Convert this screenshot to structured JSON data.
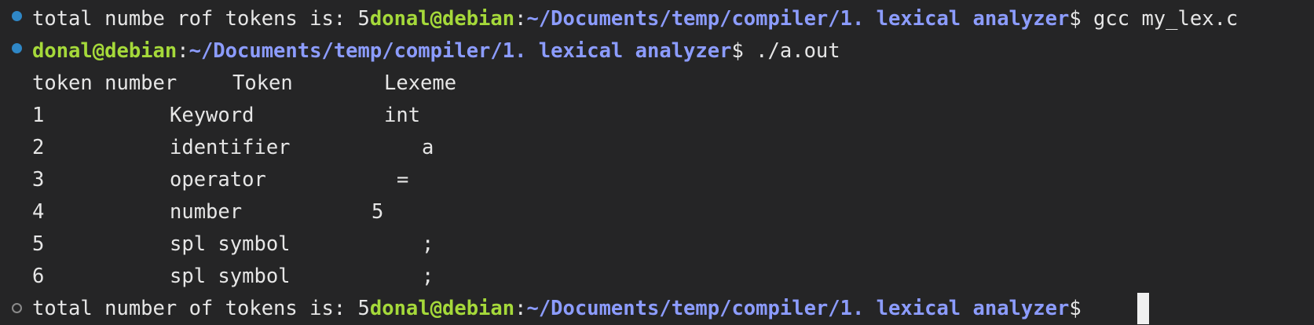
{
  "terminal": {
    "colors": {
      "background": "#252526",
      "user": "#a5d93a",
      "path": "#8c9cff",
      "text": "#e6e6e6",
      "status_dot_success": "#2f87c6",
      "status_dot_empty": "#8a8a8a"
    },
    "line1": {
      "output": "total numbe rof tokens is: 5",
      "user": "donal@debian",
      "sep": ":",
      "path": "~/Documents/temp/compiler/1. lexical analyzer",
      "prompt": "$ ",
      "command": "gcc my_lex.c"
    },
    "line2": {
      "user": "donal@debian",
      "sep": ":",
      "path": "~/Documents/temp/compiler/1. lexical analyzer",
      "prompt": "$ ",
      "command": "./a.out"
    },
    "table": {
      "headers": {
        "number": "token number",
        "token": "Token",
        "lexeme": "Lexeme"
      },
      "rows": [
        {
          "num": "1",
          "token": "Keyword",
          "lexeme": "int"
        },
        {
          "num": "2",
          "token": "identifier",
          "lexeme": "a"
        },
        {
          "num": "3",
          "token": "operator",
          "lexeme": "="
        },
        {
          "num": "4",
          "token": "number",
          "lexeme": "5"
        },
        {
          "num": "5",
          "token": "spl symbol",
          "lexeme": ";"
        },
        {
          "num": "6",
          "token": "spl symbol",
          "lexeme": ";"
        }
      ]
    },
    "line_last": {
      "output": "total number of tokens is: 5",
      "user": "donal@debian",
      "sep": ":",
      "path": "~/Documents/temp/compiler/1. lexical analyzer",
      "prompt": "$ "
    }
  }
}
